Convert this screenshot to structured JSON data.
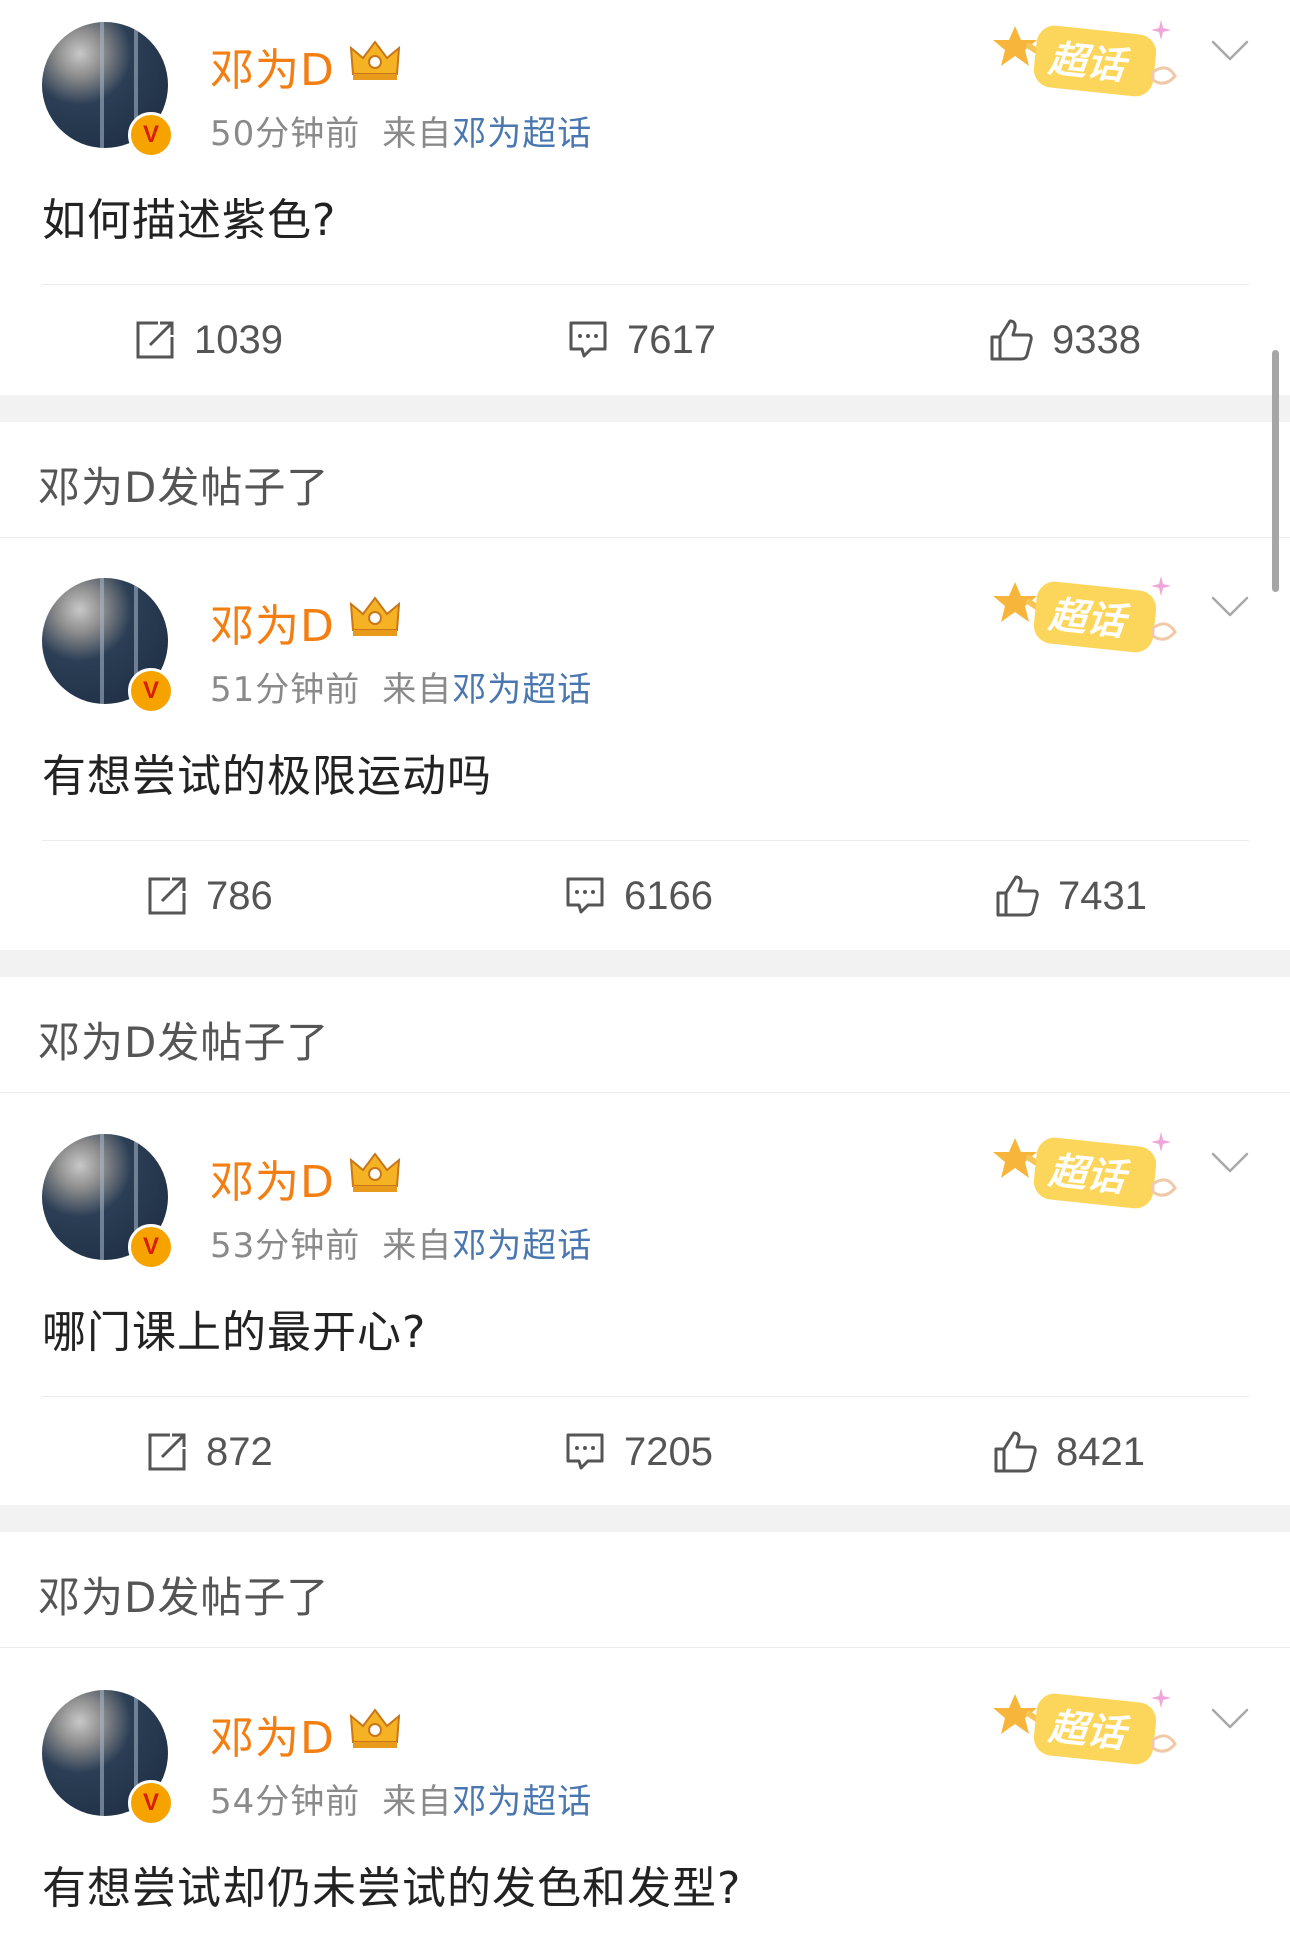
{
  "posts": [
    {
      "username": "邓为D",
      "time": "50分钟前",
      "source_prefix": "来自",
      "source_name": "邓为超话",
      "text": "如何描述紫色?",
      "reposts": "1039",
      "comments": "7617",
      "likes": "9338",
      "badge_text": "超话"
    },
    {
      "username": "邓为D",
      "time": "51分钟前",
      "source_prefix": "来自",
      "source_name": "邓为超话",
      "text": "有想尝试的极限运动吗",
      "reposts": "786",
      "comments": "6166",
      "likes": "7431",
      "badge_text": "超话"
    },
    {
      "username": "邓为D",
      "time": "53分钟前",
      "source_prefix": "来自",
      "source_name": "邓为超话",
      "text": "哪门课上的最开心?",
      "reposts": "872",
      "comments": "7205",
      "likes": "8421",
      "badge_text": "超话"
    },
    {
      "username": "邓为D",
      "time": "54分钟前",
      "source_prefix": "来自",
      "source_name": "邓为超话",
      "text": "有想尝试却仍未尝试的发色和发型?",
      "badge_text": "超话"
    }
  ],
  "section_headers": [
    "邓为D发帖子了",
    "邓为D发帖子了",
    "邓为D发帖子了"
  ],
  "colors": {
    "username": "#f37e12",
    "link": "#4a77b0",
    "meta": "#8a8a8a",
    "divider": "#f2f2f2",
    "verified_badge": "#f6a300"
  },
  "icons": {
    "repost": "repost-icon",
    "comment": "comment-icon",
    "like": "thumbs-up-icon",
    "more": "chevron-down-icon",
    "verified": "verified-v-icon",
    "crown": "crown-icon",
    "supertopic": "supertopic-badge"
  }
}
